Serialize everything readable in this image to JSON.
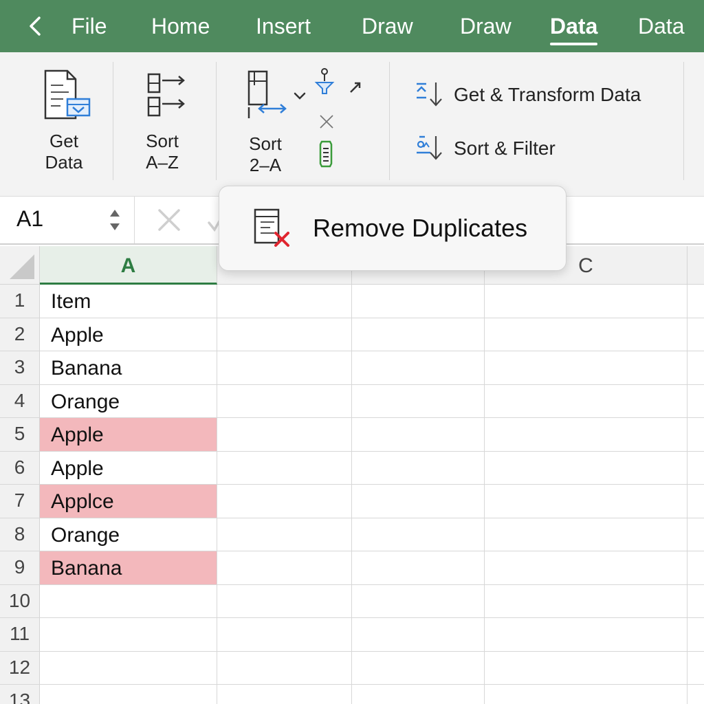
{
  "tabs": {
    "back_icon": "chevron-left-icon",
    "items": [
      {
        "label": "File",
        "active": false
      },
      {
        "label": "Home",
        "active": false
      },
      {
        "label": "Insert",
        "active": false
      },
      {
        "label": "Draw",
        "active": false
      },
      {
        "label": "Draw",
        "active": false
      },
      {
        "label": "Data",
        "active": true
      },
      {
        "label": "Data",
        "active": false
      }
    ]
  },
  "ribbon": {
    "get_data": {
      "line1": "Get",
      "line2": "Data"
    },
    "sort_az": {
      "line1": "Sort",
      "line2": "A–Z"
    },
    "sort_za": {
      "line1": "Sort",
      "line2": "2–A"
    },
    "get_transform": "Get & Transform Data",
    "sort_filter": "Sort & Filter"
  },
  "formula_bar": {
    "name_box": "A1"
  },
  "sheet": {
    "column_headers": [
      "A",
      "",
      "",
      "C"
    ],
    "active_column": "A",
    "rows": [
      {
        "num": "1",
        "value": "Item",
        "dup": false
      },
      {
        "num": "2",
        "value": "Apple",
        "dup": false
      },
      {
        "num": "3",
        "value": "Banana",
        "dup": false
      },
      {
        "num": "4",
        "value": "Orange",
        "dup": false
      },
      {
        "num": "5",
        "value": "Apple",
        "dup": true
      },
      {
        "num": "6",
        "value": "Apple",
        "dup": false
      },
      {
        "num": "7",
        "value": "Applce",
        "dup": true
      },
      {
        "num": "8",
        "value": "Orange",
        "dup": false
      },
      {
        "num": "9",
        "value": "Banana",
        "dup": true
      },
      {
        "num": "10",
        "value": "",
        "dup": false
      },
      {
        "num": "11",
        "value": "",
        "dup": false
      },
      {
        "num": "12",
        "value": "",
        "dup": false
      },
      {
        "num": "13",
        "value": "",
        "dup": false
      }
    ]
  },
  "popup": {
    "label": "Remove Duplicates",
    "icon": "remove-duplicates-icon"
  },
  "colors": {
    "tab_bar": "#4f8a5e",
    "duplicate_highlight": "#f3b8bc",
    "active_column": "#2e7d43",
    "accent_blue": "#2f7ed8",
    "delete_red": "#e0252f"
  }
}
